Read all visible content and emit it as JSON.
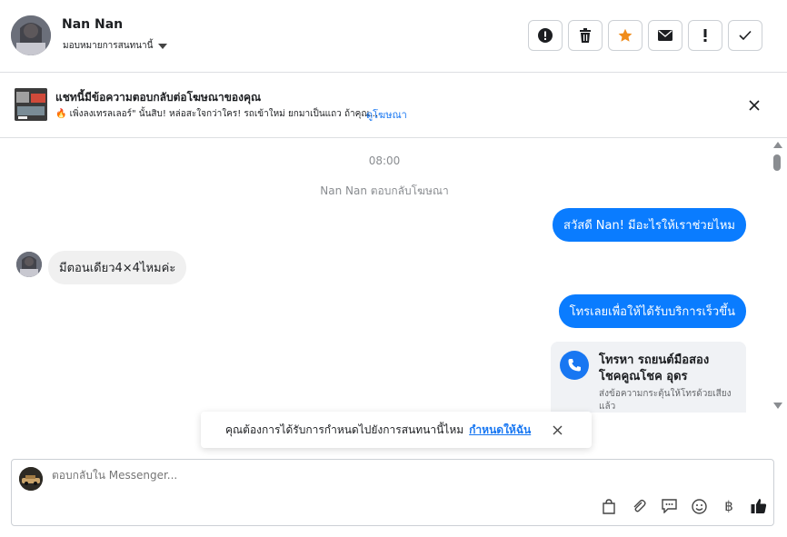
{
  "header": {
    "name": "Nan Nan",
    "assign_label": "มอบหมายการสนทนานี้",
    "actions": [
      {
        "icon": "alert-circle-icon"
      },
      {
        "icon": "trash-icon"
      },
      {
        "icon": "star-icon",
        "color": "#f08c1a"
      },
      {
        "icon": "envelope-icon"
      },
      {
        "icon": "exclamation-icon"
      },
      {
        "icon": "check-icon"
      }
    ]
  },
  "ad": {
    "title": "แชทนี้มีข้อความตอบกลับต่อโฆษณาของคุณ",
    "snippet": "🔥 เพิ่งลงเทรลเลอร์\" นั้นสิบ! หล่อสะใจกว่าใคร! รถเข้าใหม่ ยกมาเป็นแถว ถ้าคุณ...",
    "link": "ดูโฆษณา"
  },
  "thread": {
    "time": "08:00",
    "system_note": "Nan Nan ตอบกลับโฆษณา",
    "messages": [
      {
        "dir": "out",
        "text": "สวัสดี Nan! มีอะไรให้เราช่วยไหม"
      },
      {
        "dir": "in",
        "text": "มีตอนเดียว4×4ไหมค่ะ"
      },
      {
        "dir": "out",
        "text": "โทรเลยเพื่อให้ได้รับบริการเร็วขึ้น"
      }
    ],
    "call_card": {
      "title": "โทรหา รถยนต์มือสอง โชคคูณโชค อุดร",
      "subtitle": "ส่งข้อความกระตุ้นให้โทรด้วยเสียง แล้ว"
    }
  },
  "toast": {
    "text": "คุณต้องการได้รับการกำหนดไปยังการสนทนานี้ไหม",
    "link": "กำหนดให้ฉัน"
  },
  "composer": {
    "placeholder": "ตอบกลับใน Messenger...",
    "tools": [
      {
        "icon": "shopping-bag-icon"
      },
      {
        "icon": "paperclip-icon"
      },
      {
        "icon": "saved-reply-icon"
      },
      {
        "icon": "emoji-icon"
      },
      {
        "icon": "baht-icon",
        "glyph": "฿"
      },
      {
        "icon": "thumbs-up-icon"
      }
    ]
  },
  "colors": {
    "accent": "#1877f2",
    "bubble_out": "#0a7cff",
    "bubble_in": "#f0f0f0"
  }
}
